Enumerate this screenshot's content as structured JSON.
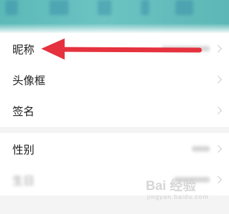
{
  "colors": {
    "header_teal": "#5bb9b8",
    "arrow_red": "#e5323e",
    "page_background": "#f4f4f4",
    "row_background": "#ffffff"
  },
  "profile_settings": {
    "rows": [
      {
        "label": "昵称"
      },
      {
        "label": "头像框"
      },
      {
        "label": "签名"
      }
    ],
    "rows_group2": [
      {
        "label": "性别"
      },
      {
        "label": "生日"
      }
    ]
  },
  "watermark": {
    "brand": "Bai 经验",
    "sub": "jingyan.baidu.com"
  },
  "annotation": {
    "type": "arrow",
    "color": "#e5323e",
    "points_to": "昵称"
  }
}
